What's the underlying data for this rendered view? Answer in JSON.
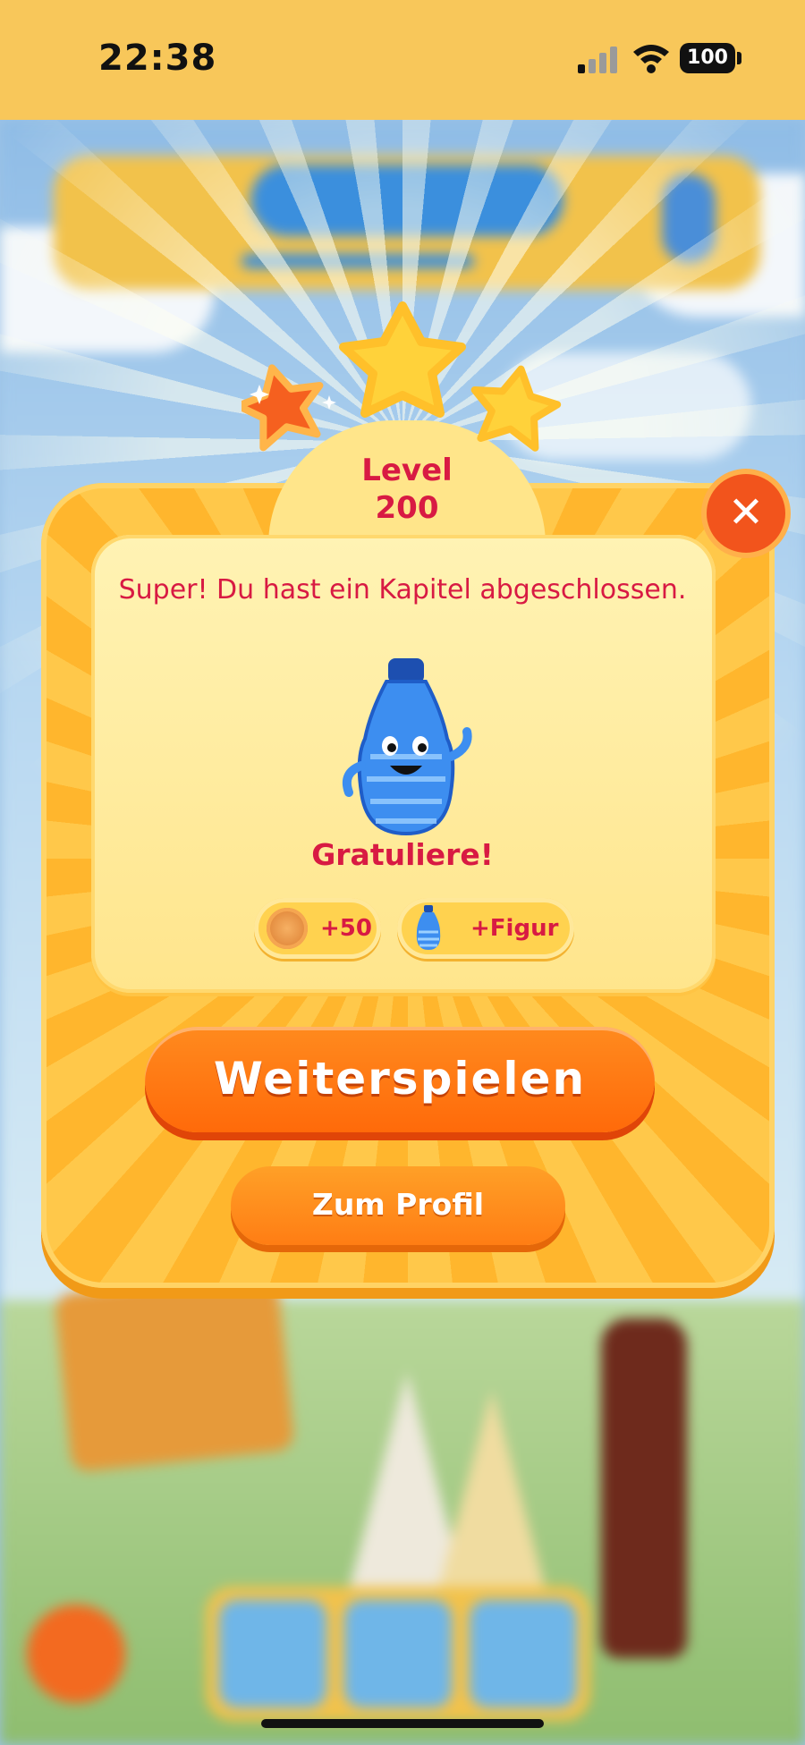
{
  "status_bar": {
    "time": "22:38",
    "battery": "100"
  },
  "dialog": {
    "level_label": "Level",
    "level_number": "200",
    "close_symbol": "✕",
    "message": "Super! Du hast ein Kapitel abgeschlossen.",
    "congrats": "Gratuliere!",
    "rewards": [
      {
        "icon": "coin-icon",
        "label": "+50"
      },
      {
        "icon": "water-bottle-character-icon",
        "label": "+Figur"
      }
    ],
    "continue_button": "Weiterspielen",
    "profile_button": "Zum Profil",
    "stars_earned": 3
  },
  "colors": {
    "status_bar": "#f8c75a",
    "accent_text": "#d81a43",
    "primary_button": "#ff6a0a",
    "panel": "#ffb62d"
  }
}
